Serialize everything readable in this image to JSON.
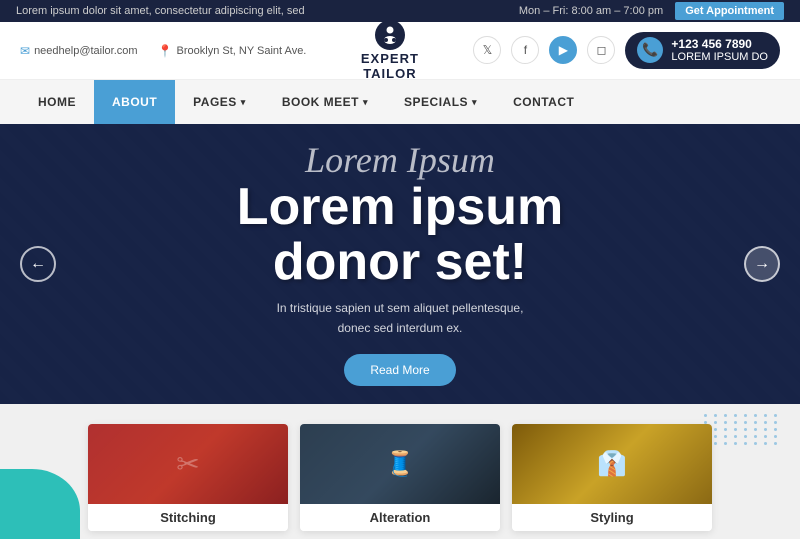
{
  "topbar": {
    "announcement": "Lorem ipsum dolor sit amet, consectetur adipiscing elit, sed",
    "hours": "Mon – Fri: 8:00 am – 7:00 pm",
    "appointment_btn": "Get Appointment"
  },
  "header": {
    "email": "needhelp@tailor.com",
    "address": "Brooklyn St, NY Saint Ave.",
    "logo_line1": "EXPERT",
    "logo_line2": "TAILOR",
    "phone_number": "+123 456 7890",
    "phone_label": "LOREM IPSUM DO",
    "social": [
      "twitter",
      "facebook",
      "youtube",
      "instagram"
    ]
  },
  "nav": {
    "items": [
      {
        "label": "HOME",
        "active": false,
        "has_dropdown": false
      },
      {
        "label": "ABOUT",
        "active": true,
        "has_dropdown": false
      },
      {
        "label": "PAGES",
        "active": false,
        "has_dropdown": true
      },
      {
        "label": "BOOK MEET",
        "active": false,
        "has_dropdown": true
      },
      {
        "label": "SPECIALS",
        "active": false,
        "has_dropdown": true
      },
      {
        "label": "CONTACT",
        "active": false,
        "has_dropdown": false
      }
    ]
  },
  "hero": {
    "cursive_text": "Lorem Ipsum",
    "main_title_line1": "Lorem ipsum",
    "main_title_line2": "donor set!",
    "subtitle": "In tristique sapien ut sem aliquet pellentesque, donec sed interdum ex.",
    "read_more_btn": "Read More"
  },
  "services": {
    "cards": [
      {
        "label": "Stitching",
        "type": "stitching"
      },
      {
        "label": "Alteration",
        "type": "alteration"
      },
      {
        "label": "Styling",
        "type": "styling"
      }
    ]
  }
}
